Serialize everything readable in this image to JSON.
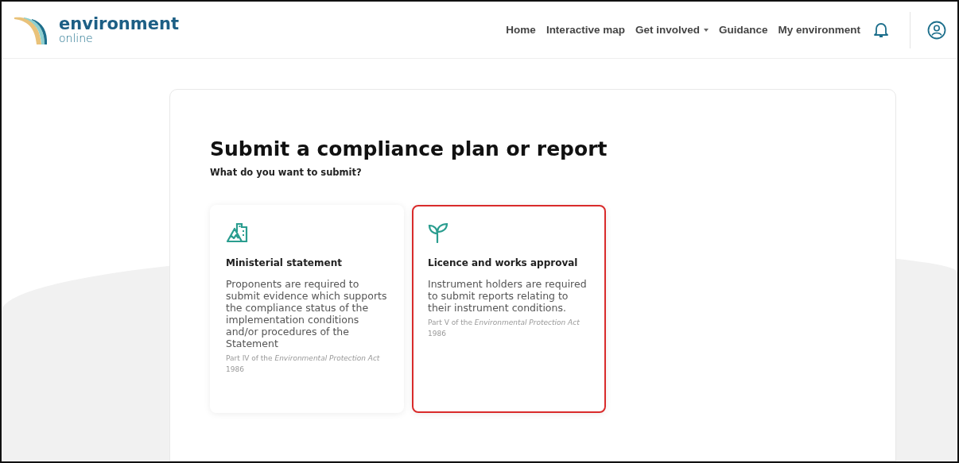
{
  "logo": {
    "name": "environment",
    "tagline": "online"
  },
  "nav": [
    {
      "label": "Home",
      "dropdown": false
    },
    {
      "label": "Interactive map",
      "dropdown": false
    },
    {
      "label": "Get involved",
      "dropdown": true
    },
    {
      "label": "Guidance",
      "dropdown": false
    },
    {
      "label": "My environment",
      "dropdown": false
    }
  ],
  "title": "Submit a compliance plan or report",
  "question": "What do you want to submit?",
  "options": [
    {
      "kind": "buildings",
      "title": "Ministerial statement",
      "description": "Proponents are required to submit evidence which supports the compliance status of the implementation conditions and/or procedures of the Statement",
      "reference": "Part IV of the *Environmental Protection Act* 1986",
      "highlighted": false
    },
    {
      "kind": "sprout",
      "title": "Licence and works approval",
      "description": "Instrument holders are required to submit reports relating to their instrument conditions.",
      "reference": "Part V of the *Environmental Protection Act* 1986",
      "highlighted": true
    }
  ]
}
